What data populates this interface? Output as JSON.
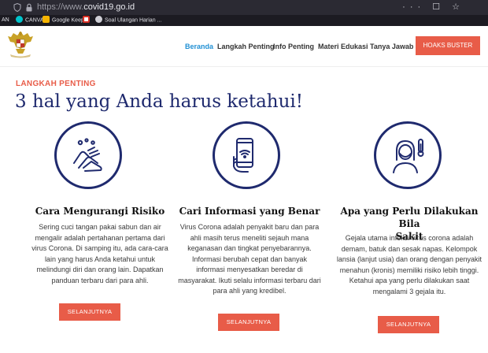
{
  "browser": {
    "url_prefix": "https://www.",
    "url_domain": "covid19.go.id",
    "right_icons": "··· ☐ ☆",
    "bookmarks": [
      {
        "label": "AN",
        "icon": "none"
      },
      {
        "label": "CANVA",
        "icon": "canva-icon"
      },
      {
        "label": "Google Keep",
        "icon": "keep-icon"
      },
      {
        "label": "",
        "icon": "gmail-icon"
      },
      {
        "label": "Soal Ulangan Harian ...",
        "icon": "globe-icon"
      }
    ]
  },
  "header": {
    "logo": "garuda-pancasila-logo",
    "nav": [
      "Beranda",
      "Langkah Penting",
      "Info Penting",
      "Materi Edukasi",
      "Tanya Jawab"
    ],
    "active_index": 0,
    "cta": "HOAKS BUSTER"
  },
  "section": {
    "eyebrow": "LANGKAH PENTING",
    "heading": "3 hal yang Anda harus ketahui!"
  },
  "columns": [
    {
      "icon": "hand-washing-icon",
      "title": "Cara Mengurangi Risiko",
      "lines": [
        "Sering cuci tangan pakai sabun dan air",
        "mengalir adalah pertahanan pertama dari",
        "virus Corona. Di samping itu, ada cara-cara",
        "lain yang harus Anda ketahui untuk",
        "melindungi diri dan orang lain. Dapatkan",
        "panduan terbaru dari para ahli."
      ],
      "button": "SELANJUTNYA"
    },
    {
      "icon": "smartphone-hand-icon",
      "title": "Cari Informasi yang Benar",
      "lines": [
        "Virus Corona adalah penyakit baru dan para",
        "ahli masih terus meneliti sejauh mana",
        "keganasan dan tingkat penyebarannya.",
        "Informasi berubah cepat dan banyak",
        "informasi menyesatkan beredar di",
        "masyarakat. Ikuti selalu informasi terbaru dari",
        "para ahli yang kredibel."
      ],
      "button": "SELANJUTNYA"
    },
    {
      "icon": "sick-person-thermometer-icon",
      "title_lines": [
        "Apa yang Perlu Dilakukan Bila",
        "Sakit"
      ],
      "lines": [
        "Gejala utama infeksi virus corona adalah",
        "demam, batuk dan sesak napas. Kelompok",
        "lansia (lanjut usia) dan orang dengan penyakit",
        "menahun (kronis) memiliki risiko lebih tinggi.",
        "Ketahui apa yang perlu dilakukan saat",
        "mengalami 3 gejala itu."
      ],
      "button": "SELANJUTNYA"
    }
  ],
  "colors": {
    "accent": "#e85c48",
    "navy": "#1f2a6e",
    "nav_active": "#2190d4"
  }
}
